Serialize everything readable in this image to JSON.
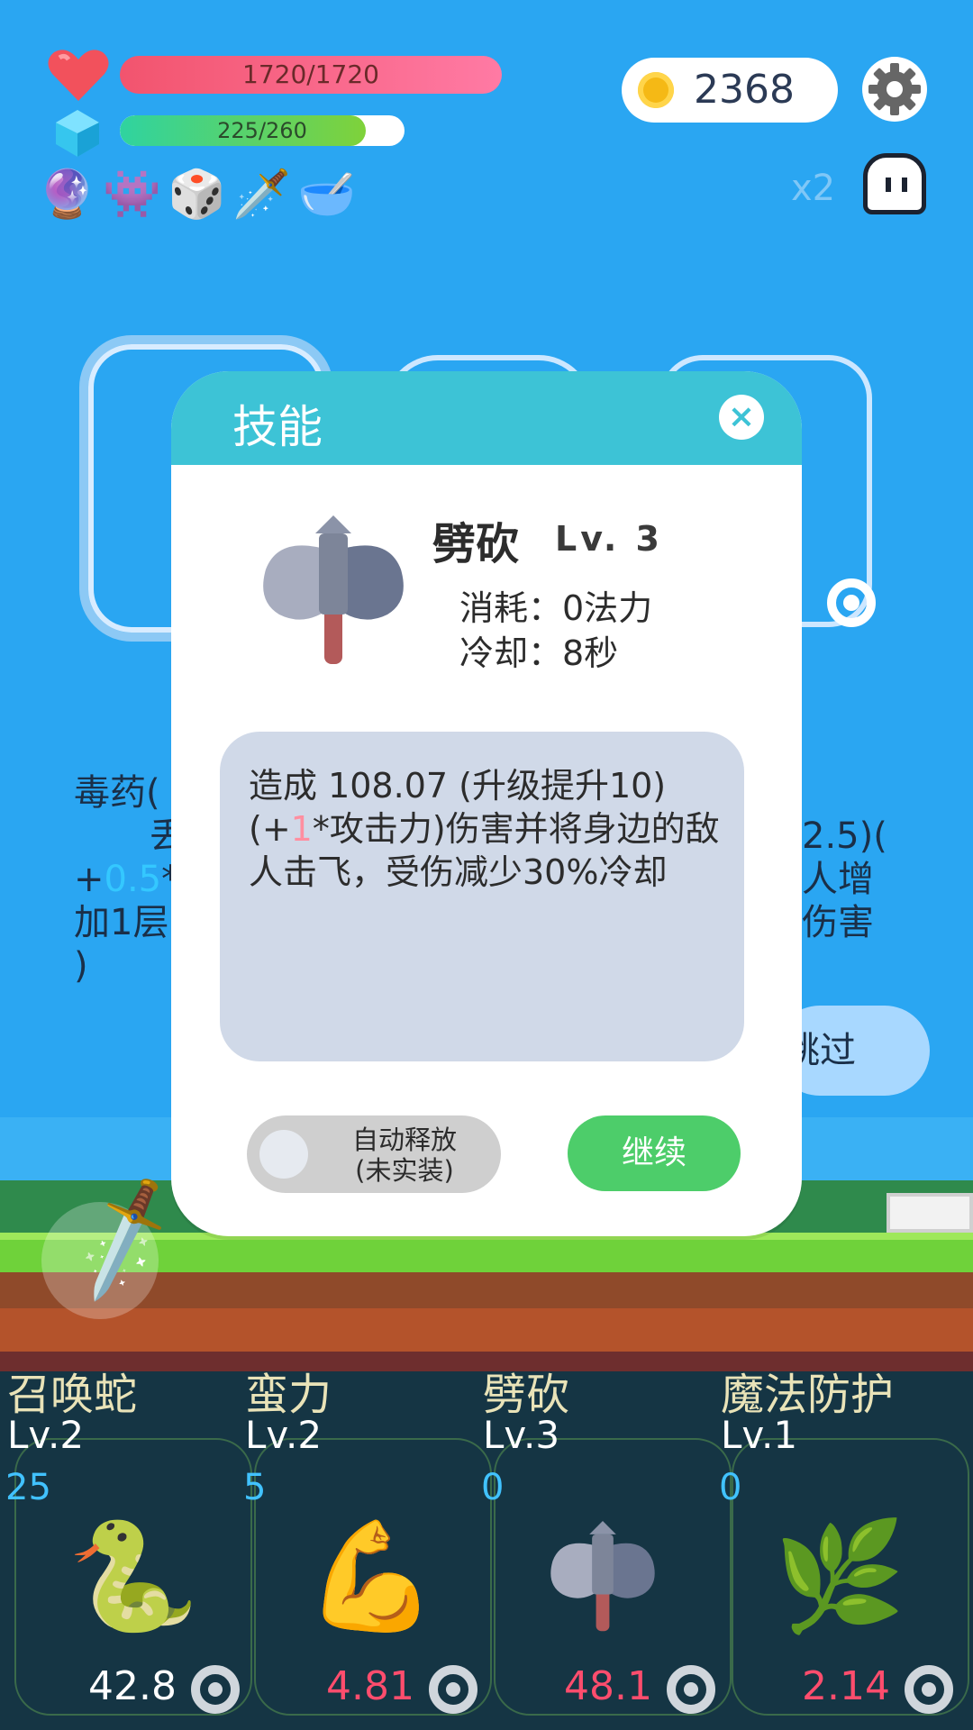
{
  "hud": {
    "hp_text": "1720/1720",
    "hp_fraction": 1.0,
    "mp_text": "225/260",
    "mp_fraction": 0.865,
    "coins": "2368",
    "speed": "x2",
    "icons": [
      "heart-icon",
      "gem-icon",
      "coin-icon",
      "gear-icon",
      "ghost-icon"
    ],
    "relics": [
      {
        "name": "crystal-ball",
        "glyph": "🔮"
      },
      {
        "name": "green-monster",
        "glyph": "👾"
      },
      {
        "name": "dice",
        "glyph": "🎲"
      },
      {
        "name": "sword",
        "glyph": "🗡️"
      },
      {
        "name": "mortar-pestle",
        "glyph": "🥣"
      }
    ]
  },
  "background": {
    "left_text_l1": "毒药",
    "left_text_l1b": "(",
    "left_text_l2": "丢",
    "left_text_l3_pre": "+",
    "left_text_l3_num": "0.5",
    "left_text_l3_post": "*",
    "left_text_l4": "加1层",
    "left_text_l5": ")",
    "right_text_l1": "2.5)(",
    "right_text_l2": "人增",
    "right_text_l3": "伤害",
    "skip_label": "跳过"
  },
  "modal": {
    "title": "技能",
    "close_glyph": "×",
    "skill_name": "劈砍",
    "skill_level": "Lv. 3",
    "cost": "消耗：0法力",
    "cooldown": "冷却：8秒",
    "desc_part1": "造成 108.07 (升级提升10)(+",
    "desc_highlight": "1",
    "desc_part2": "*攻击力)伤害并将身边的敌人击飞，受伤减少30%冷却",
    "auto_cast_l1": "自动释放",
    "auto_cast_l2": "(未实装)",
    "auto_cast_on": false,
    "continue_label": "继续"
  },
  "skills": [
    {
      "name": "召唤蛇",
      "level": "Lv.2",
      "count": "25",
      "value": "42.8",
      "value_color": "#ffffff",
      "glyph": "🐍"
    },
    {
      "name": "蛮力",
      "level": "Lv.2",
      "count": "5",
      "value": "4.81",
      "value_color": "#ff4d6d",
      "glyph": "💪"
    },
    {
      "name": "劈砍",
      "level": "Lv.3",
      "count": "0",
      "value": "48.1",
      "value_color": "#ff4d6d",
      "glyph": "🪓"
    },
    {
      "name": "魔法防护",
      "level": "Lv.1",
      "count": "0",
      "value": "2.14",
      "value_color": "#ff4d6d",
      "glyph": "🌿"
    }
  ]
}
